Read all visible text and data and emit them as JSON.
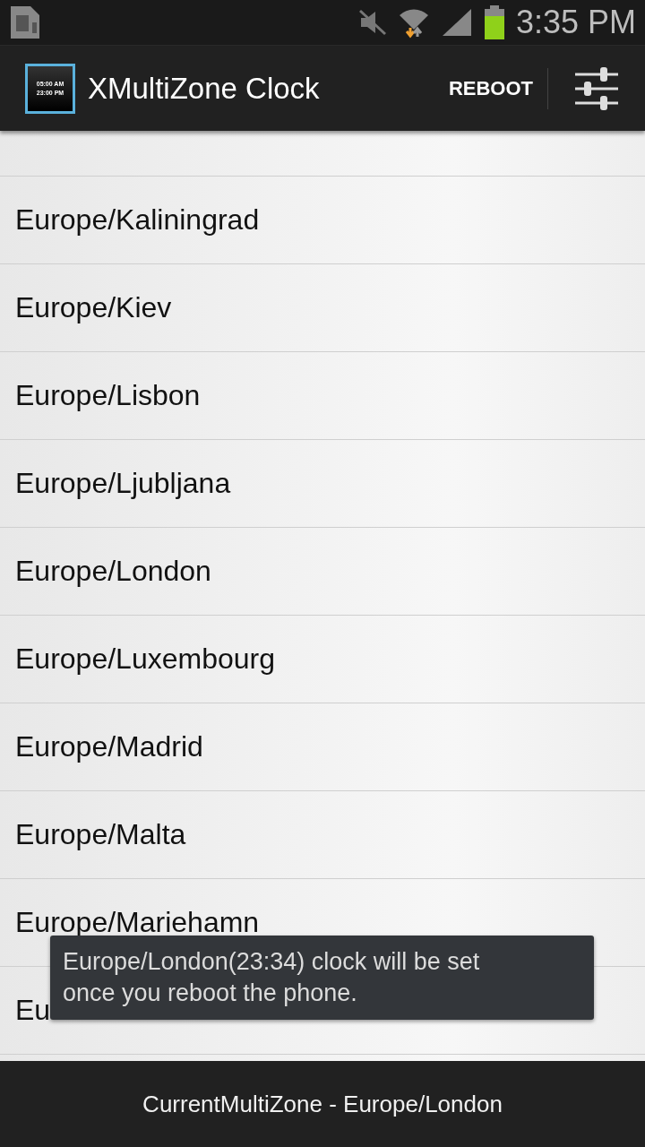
{
  "status_bar": {
    "time": "3:35 PM"
  },
  "app_bar": {
    "title": "XMultiZone Clock",
    "logo_lines": [
      "05:00 AM",
      "23:00 PM"
    ],
    "action": "REBOOT"
  },
  "zones": [
    {
      "name": "Europe/Kaliningrad"
    },
    {
      "name": "Europe/Kiev"
    },
    {
      "name": "Europe/Lisbon"
    },
    {
      "name": "Europe/Ljubljana"
    },
    {
      "name": "Europe/London"
    },
    {
      "name": "Europe/Luxembourg"
    },
    {
      "name": "Europe/Madrid"
    },
    {
      "name": "Europe/Malta"
    },
    {
      "name": "Europe/Mariehamn"
    },
    {
      "name": "Eu"
    }
  ],
  "toast": {
    "text": "Europe/London(23:34) clock will be set once you reboot the phone."
  },
  "footer": {
    "text": "CurrentMultiZone - Europe/London"
  }
}
